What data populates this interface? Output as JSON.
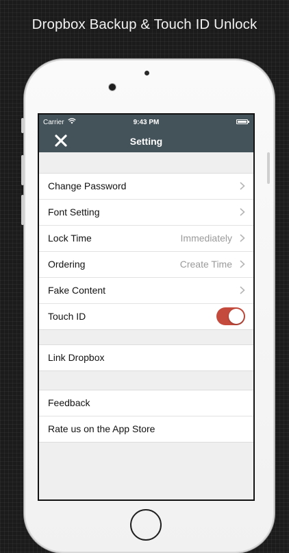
{
  "headline": "Dropbox Backup & Touch ID Unlock",
  "status_bar": {
    "carrier": "Carrier",
    "time": "9:43 PM"
  },
  "nav": {
    "title": "Setting",
    "close_icon": "close-icon"
  },
  "groups": [
    {
      "items": [
        {
          "label": "Change Password",
          "value": "",
          "accessory": "chevron"
        },
        {
          "label": "Font Setting",
          "value": "",
          "accessory": "chevron"
        },
        {
          "label": "Lock Time",
          "value": "Immediately",
          "accessory": "chevron"
        },
        {
          "label": "Ordering",
          "value": "Create Time",
          "accessory": "chevron"
        },
        {
          "label": "Fake Content",
          "value": "",
          "accessory": "chevron"
        },
        {
          "label": "Touch ID",
          "value": "",
          "accessory": "toggle",
          "toggle_on": true
        }
      ]
    },
    {
      "items": [
        {
          "label": "Link Dropbox",
          "value": "",
          "accessory": "none"
        }
      ]
    },
    {
      "items": [
        {
          "label": "Feedback",
          "value": "",
          "accessory": "none"
        },
        {
          "label": "Rate us on the App Store",
          "value": "",
          "accessory": "none"
        }
      ]
    }
  ],
  "colors": {
    "nav_bar": "#44535a",
    "toggle_on": "#c34a3c",
    "background": "#efefef"
  }
}
